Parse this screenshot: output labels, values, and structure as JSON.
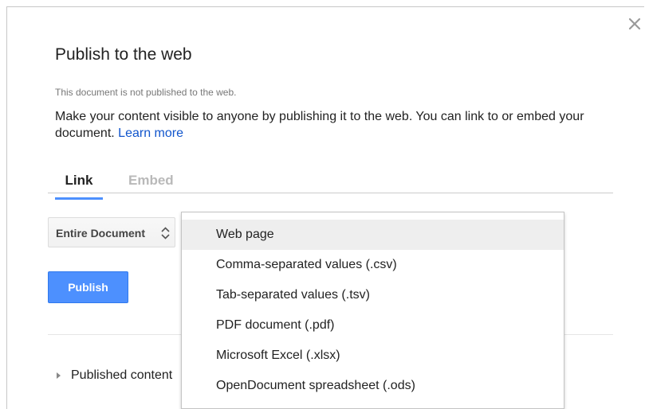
{
  "dialog": {
    "title": "Publish to the web",
    "status": "This document is not published to the web.",
    "description": "Make your content visible to anyone by publishing it to the web. You can link to or embed your document.",
    "learn_more": "Learn more",
    "close_icon": "close-icon"
  },
  "tabs": [
    {
      "label": "Link",
      "active": true
    },
    {
      "label": "Embed",
      "active": false
    }
  ],
  "scope_select": {
    "value": "Entire Document",
    "icon": "updown-arrows-icon"
  },
  "publish_label": "Publish",
  "published_content": {
    "label": "Published content",
    "icon": "expand-triangle-icon"
  },
  "format_menu": {
    "selected": "Web page",
    "items": [
      "Web page",
      "Comma-separated values (.csv)",
      "Tab-separated values (.tsv)",
      "PDF document (.pdf)",
      "Microsoft Excel (.xlsx)",
      "OpenDocument spreadsheet (.ods)"
    ]
  },
  "colors": {
    "accent": "#4d90fe",
    "link": "#1155cc",
    "menu_highlight": "#eeeeee"
  }
}
